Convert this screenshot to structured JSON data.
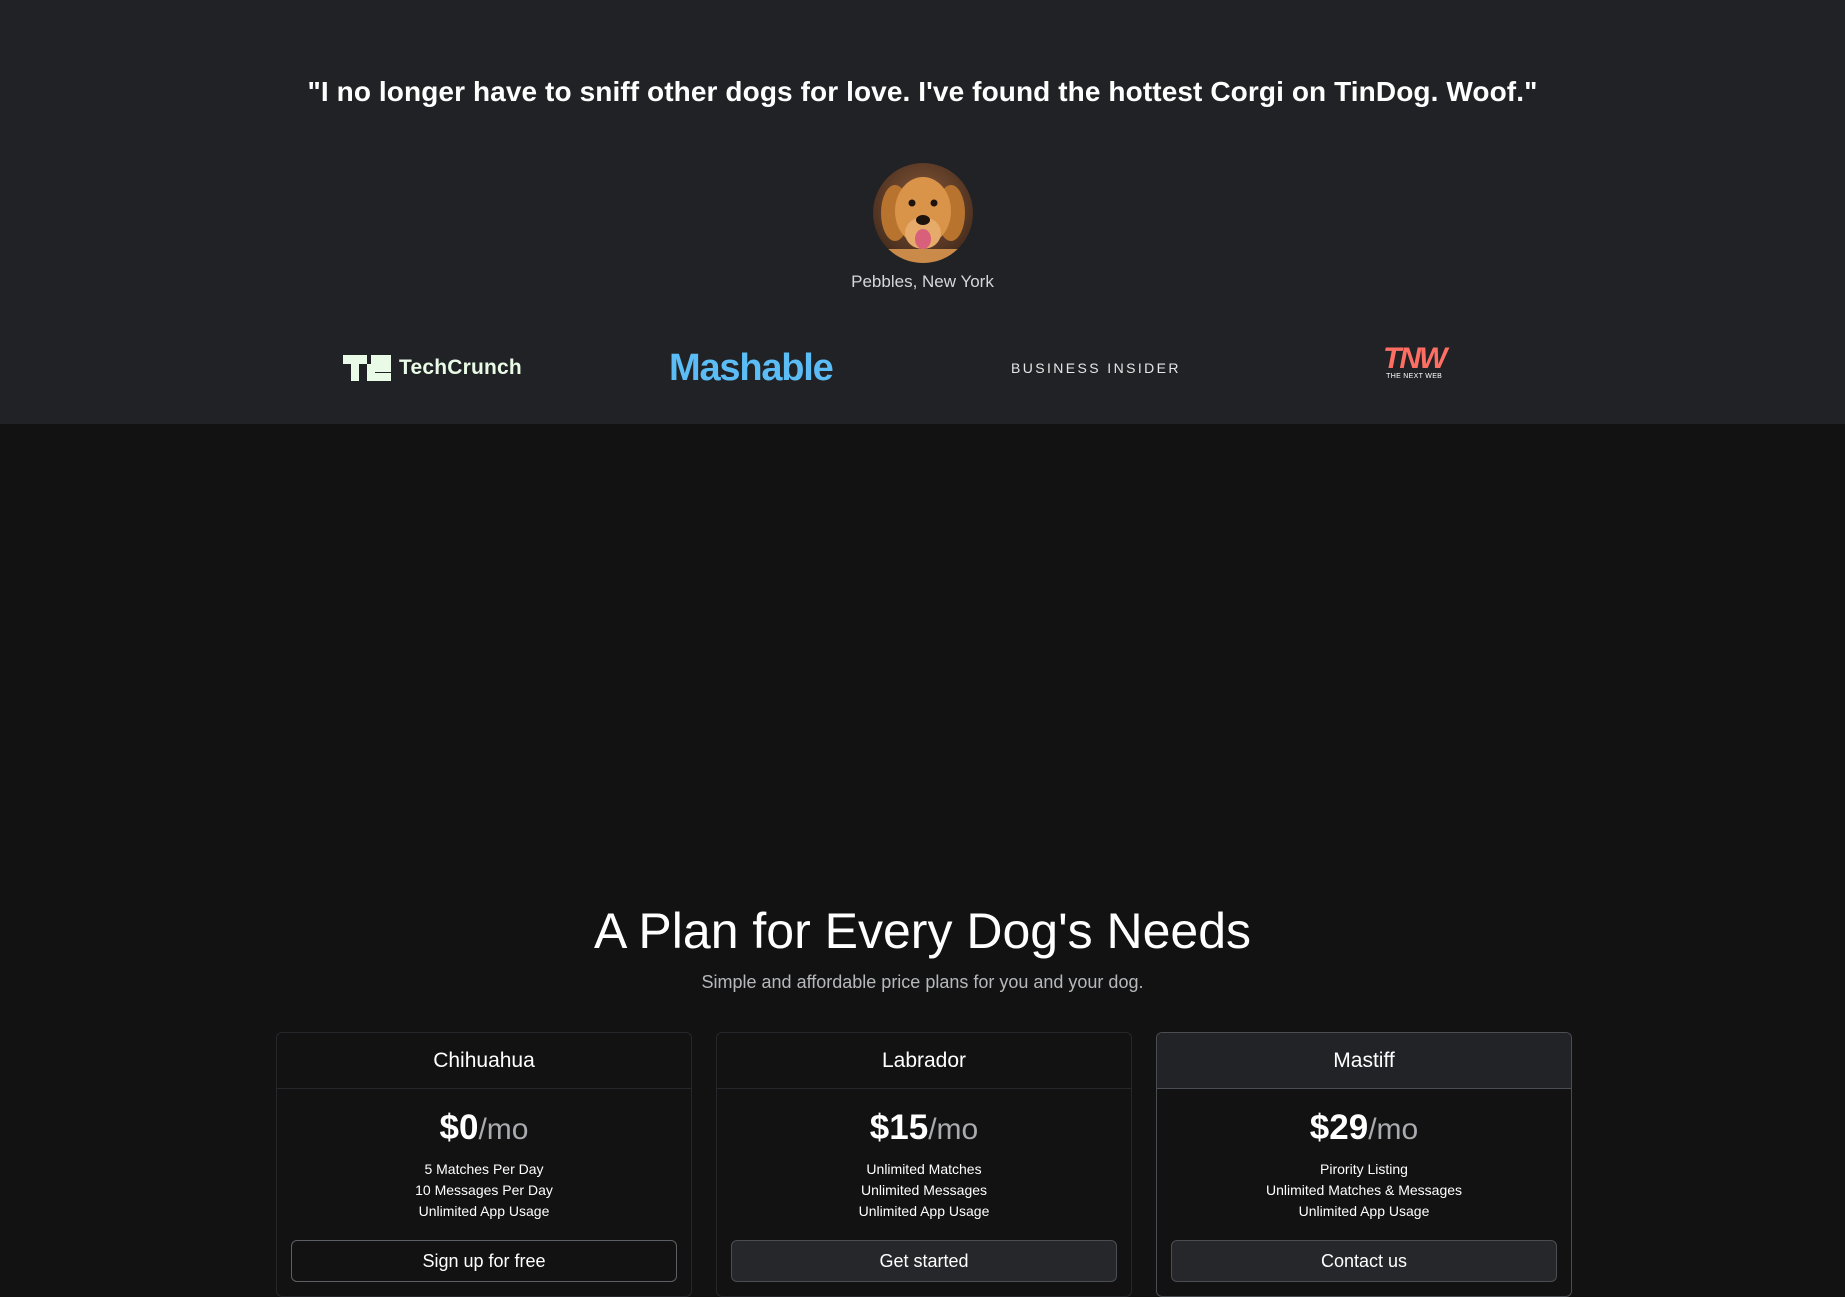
{
  "testimonial": {
    "quote": "\"I no longer have to sniff other dogs for love. I've found the hottest Corgi on TinDog. Woof.\"",
    "author": "Pebbles, New York",
    "avatar_icon": "golden-retriever-photo"
  },
  "press": {
    "techcrunch": "TechCrunch",
    "mashable": "Mashable",
    "business_insider": "BUSINESS INSIDER",
    "tnw_logo": "TNW",
    "tnw_sub": "THE NEXT WEB",
    "colors": {
      "techcrunch": "#e9fbe7",
      "mashable": "#5cbcf5",
      "tnw": "#ff6e63"
    }
  },
  "pricing": {
    "title": "A Plan for Every Dog's Needs",
    "subtitle": "Simple and affordable price plans for you and your dog.",
    "plans": [
      {
        "name": "Chihuahua",
        "price": "$0",
        "unit": "/mo",
        "features": [
          "5 Matches Per Day",
          "10 Messages Per Day",
          "Unlimited App Usage"
        ],
        "button": "Sign up for free"
      },
      {
        "name": "Labrador",
        "price": "$15",
        "unit": "/mo",
        "features": [
          "Unlimited Matches",
          "Unlimited Messages",
          "Unlimited App Usage"
        ],
        "button": "Get started"
      },
      {
        "name": "Mastiff",
        "price": "$29",
        "unit": "/mo",
        "features": [
          "Pirority Listing",
          "Unlimited Matches & Messages",
          "Unlimited App Usage"
        ],
        "button": "Contact us"
      }
    ]
  }
}
